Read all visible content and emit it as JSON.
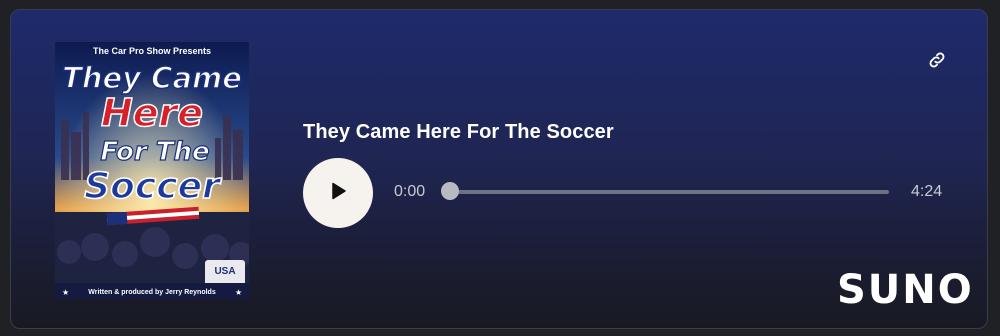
{
  "cover": {
    "presenter": "The Car Pro Show Presents",
    "line1": "They Came",
    "line2": "Here",
    "line3": "For The",
    "line4": "Soccer",
    "credit": "Written & produced by Jerry Reynolds",
    "jersey": "USA"
  },
  "track": {
    "title": "They Came Here For The Soccer",
    "current_time": "0:00",
    "duration": "4:24",
    "progress": 0
  },
  "brand": {
    "name": "SUNO"
  },
  "colors": {
    "play_button": "#f6f2ee",
    "progress_track": "#6f7282",
    "background_top": "#1e2a6b",
    "background_bottom": "#181a22"
  },
  "icons": {
    "share": "link-icon",
    "play": "play-icon"
  }
}
